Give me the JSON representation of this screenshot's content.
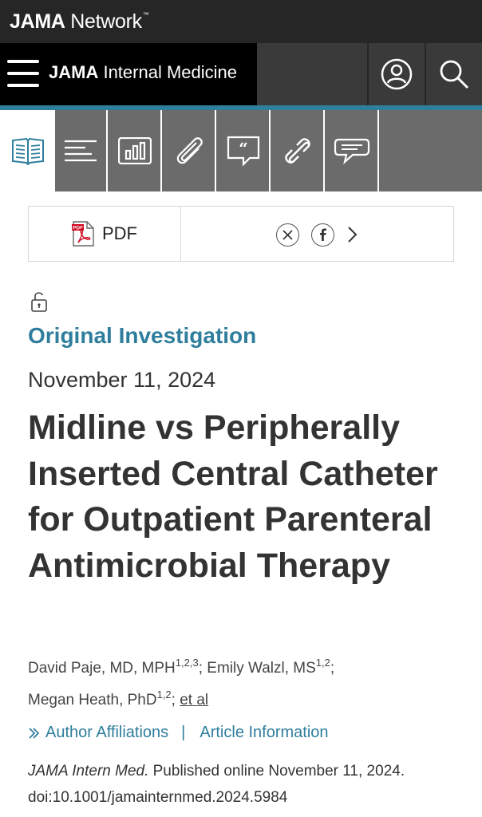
{
  "network_bar": {
    "logo_bold": "JAMA",
    "logo_rest": " Network",
    "trademark": "™"
  },
  "header": {
    "journal_bold": "JAMA",
    "journal_rest": " Internal Medicine"
  },
  "toolbar": {
    "icons": [
      "article-icon",
      "outline-icon",
      "figures-icon",
      "attachment-icon",
      "cite-icon",
      "permissions-icon",
      "comment-icon"
    ]
  },
  "actions": {
    "pdf_label": "PDF"
  },
  "article": {
    "type": "Original Investigation",
    "date": "November 11, 2024",
    "title": "Midline vs Peripherally Inserted Central Catheter for Outpatient Parenteral Antimicrobial Therapy",
    "authors": [
      {
        "name": "David Paje, MD, MPH",
        "affil": "1,2,3"
      },
      {
        "name": "Emily Walzl, MS",
        "affil": "1,2"
      },
      {
        "name": "Megan Heath, PhD",
        "affil": "1,2"
      }
    ],
    "et_al": "et al",
    "author_affiliations_label": "Author Affiliations",
    "article_information_label": "Article Information",
    "citation_journal": "JAMA Intern Med.",
    "citation_text": " Published online November 11, 2024.",
    "doi": "doi:10.1001/jamainternmed.2024.5984"
  },
  "colors": {
    "accent": "#2f7e9d",
    "topbar": "#262626",
    "toolbar": "#6b6b6b"
  }
}
